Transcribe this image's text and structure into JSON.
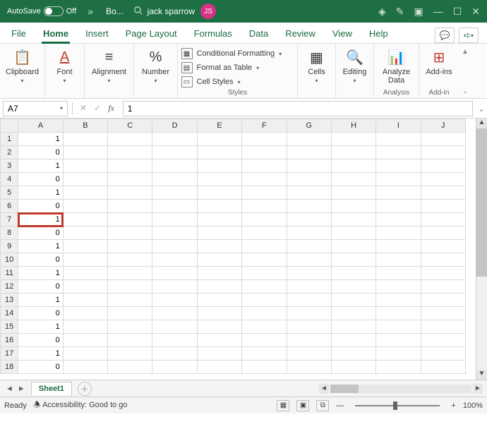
{
  "titlebar": {
    "autosave_label": "AutoSave",
    "autosave_state": "Off",
    "doc_name": "Bo...",
    "user_name": "jack sparrow",
    "user_initials": "JS"
  },
  "tabs": {
    "file": "File",
    "home": "Home",
    "insert": "Insert",
    "page_layout": "Page Layout",
    "formulas": "Formulas",
    "data": "Data",
    "review": "Review",
    "view": "View",
    "help": "Help"
  },
  "ribbon": {
    "clipboard": "Clipboard",
    "font": "Font",
    "alignment": "Alignment",
    "number": "Number",
    "cond_format": "Conditional Formatting",
    "format_table": "Format as Table",
    "cell_styles": "Cell Styles",
    "styles": "Styles",
    "cells": "Cells",
    "editing": "Editing",
    "analyze_data": "Analyze Data",
    "analysis": "Analysis",
    "addins": "Add-ins",
    "addin_grp": "Add-in"
  },
  "namebox": "A7",
  "formula_value": "1",
  "columns": [
    "A",
    "B",
    "C",
    "D",
    "E",
    "F",
    "G",
    "H",
    "I",
    "J"
  ],
  "rows": [
    {
      "n": 1,
      "a": "1"
    },
    {
      "n": 2,
      "a": "0"
    },
    {
      "n": 3,
      "a": "1"
    },
    {
      "n": 4,
      "a": "0"
    },
    {
      "n": 5,
      "a": "1"
    },
    {
      "n": 6,
      "a": "0"
    },
    {
      "n": 7,
      "a": "1"
    },
    {
      "n": 8,
      "a": "0"
    },
    {
      "n": 9,
      "a": "1"
    },
    {
      "n": 10,
      "a": "0"
    },
    {
      "n": 11,
      "a": "1"
    },
    {
      "n": 12,
      "a": "0"
    },
    {
      "n": 13,
      "a": "1"
    },
    {
      "n": 14,
      "a": "0"
    },
    {
      "n": 15,
      "a": "1"
    },
    {
      "n": 16,
      "a": "0"
    },
    {
      "n": 17,
      "a": "1"
    },
    {
      "n": 18,
      "a": "0"
    }
  ],
  "selected_row": 7,
  "sheet_tab": "Sheet1",
  "status": {
    "ready": "Ready",
    "accessibility": "Accessibility: Good to go",
    "zoom": "100%"
  }
}
